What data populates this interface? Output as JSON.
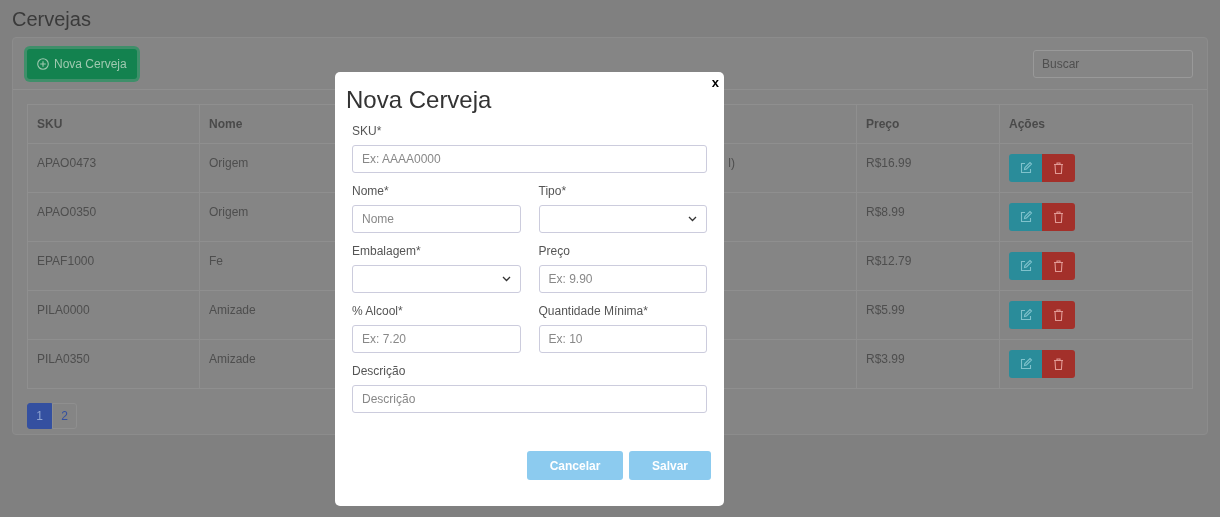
{
  "page": {
    "title": "Cervejas"
  },
  "toolbar": {
    "new_button": "Nova Cerveja",
    "search": {
      "placeholder": "Buscar"
    }
  },
  "table": {
    "columns": [
      "SKU",
      "Nome",
      "Preço",
      "Ações"
    ],
    "rows": [
      {
        "sku": "APAO0473",
        "nome": "Origem",
        "column_3": "l)",
        "preco": "R$16.99"
      },
      {
        "sku": "APAO0350",
        "nome": "Origem",
        "preco": "R$8.99"
      },
      {
        "sku": "EPAF1000",
        "nome": "Fe",
        "preco": "R$12.79"
      },
      {
        "sku": "PILA0000",
        "nome": "Amizade",
        "preco": "R$5.99"
      },
      {
        "sku": "PILA0350",
        "nome": "Amizade",
        "preco": "R$3.99"
      }
    ]
  },
  "pagination": [
    {
      "label": "1",
      "selected": true
    },
    {
      "label": "2",
      "selected": false
    }
  ],
  "modal": {
    "title": "Nova Cerveja",
    "close": "x",
    "form_rows": [
      [
        {
          "kind": "input",
          "label": "SKU*",
          "placeholder": "Ex: AAAA0000"
        }
      ],
      [
        {
          "kind": "input",
          "label": "Nome*",
          "placeholder": "Nome"
        },
        {
          "kind": "select",
          "label": "Tipo*"
        }
      ],
      [
        {
          "kind": "select",
          "label": "Embalagem*"
        },
        {
          "kind": "input",
          "label": "Preço",
          "placeholder": "Ex: 9.90"
        }
      ],
      [
        {
          "kind": "input",
          "label": "% Alcool*",
          "placeholder": "Ex: 7.20"
        },
        {
          "kind": "input",
          "label": "Quantidade Mínima*",
          "placeholder": "Ex: 10"
        }
      ],
      [
        {
          "kind": "input",
          "label": "Descrição",
          "placeholder": "Descrição"
        }
      ]
    ],
    "buttons": [
      {
        "label": "Cancelar",
        "disabled": true
      },
      {
        "label": "Salvar",
        "disabled": true
      }
    ]
  }
}
